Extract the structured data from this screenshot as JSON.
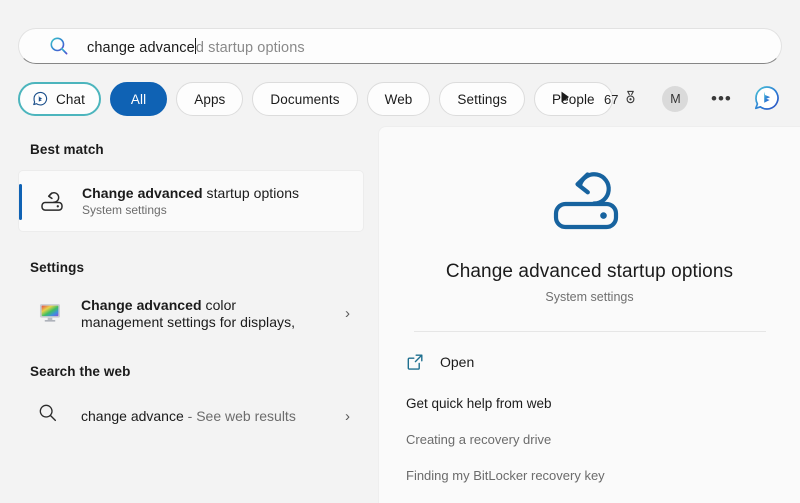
{
  "search": {
    "icon": "search-icon",
    "typed_text": "change advance",
    "ghost_text": "d startup options",
    "full_value": "change advanced startup options"
  },
  "filters": {
    "chat": {
      "label": "Chat",
      "icon": "bing-chat-icon"
    },
    "pills": [
      {
        "label": "All",
        "selected": true
      },
      {
        "label": "Apps",
        "selected": false
      },
      {
        "label": "Documents",
        "selected": false
      },
      {
        "label": "Web",
        "selected": false
      },
      {
        "label": "Settings",
        "selected": false
      },
      {
        "label": "People",
        "selected": false
      }
    ],
    "more_arrow": "play-arrow-icon",
    "rewards_points": "67",
    "rewards_icon": "medal-icon",
    "account_initial": "M",
    "overflow": "•••",
    "bing_logo": "bing-logo-icon",
    "accent_color": "#0f62b4",
    "chat_border_color": "#4cb5bd"
  },
  "left": {
    "best_match_heading": "Best match",
    "best_match": {
      "title_bold": "Change advanced",
      "title_rest": " startup options",
      "subtitle": "System settings",
      "icon": "recovery-drive-icon"
    },
    "settings_heading": "Settings",
    "settings_item": {
      "title_bold": "Change advanced",
      "title_rest": " color",
      "title_line2": "management settings for displays,",
      "icon": "color-monitor-icon",
      "chevron": "›"
    },
    "web_heading": "Search the web",
    "web_item": {
      "query": "change advance",
      "suffix": " - See web results",
      "icon": "search-icon",
      "chevron": "›"
    }
  },
  "preview": {
    "hero_icon": "recovery-drive-large-icon",
    "title": "Change advanced startup options",
    "subtitle": "System settings",
    "open_label": "Open",
    "open_icon": "external-link-icon",
    "web_help_heading": "Get quick help from web",
    "web_help_links": [
      "Creating a recovery drive",
      "Finding my BitLocker recovery key"
    ]
  }
}
